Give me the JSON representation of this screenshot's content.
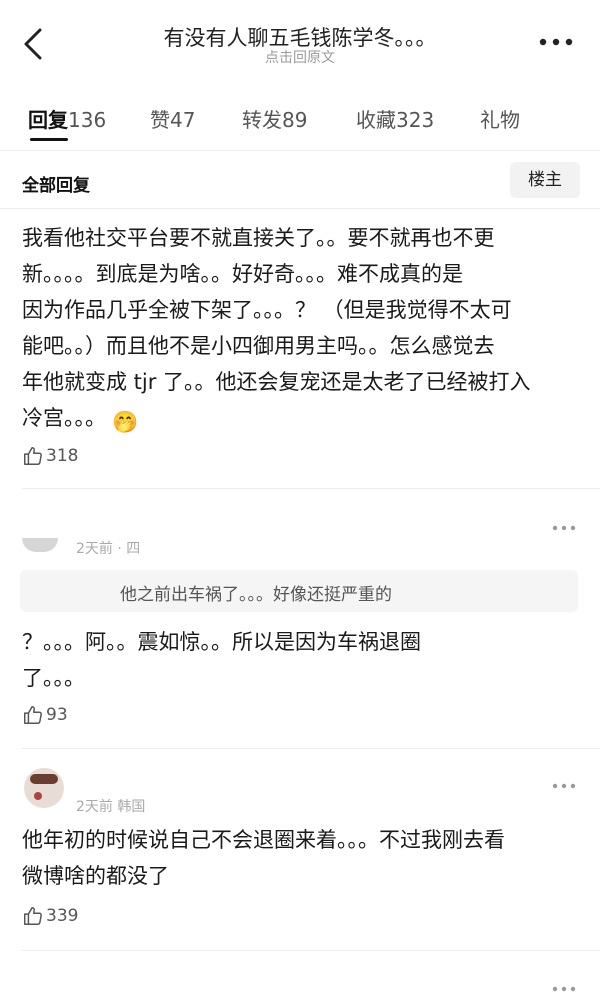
{
  "header": {
    "title": "有没有人聊五毛钱陈学冬。。。",
    "subtitle": "点击回原文"
  },
  "tabs": [
    {
      "label": "回复",
      "count": "136"
    },
    {
      "label": "赞",
      "count": "47"
    },
    {
      "label": "转发",
      "count": "89"
    },
    {
      "label": "收藏",
      "count": "323"
    },
    {
      "label": "礼物",
      "count": ""
    }
  ],
  "section": {
    "all_replies": "全部回复",
    "owner_button": "楼主"
  },
  "comments": [
    {
      "lines": [
        "我看他社交平台要不就直接关了。。要不就再也不更",
        "新。。。。到底是为啥。。好好奇。。。难不成真的是",
        "因为作品几乎全被下架了。。。？ （但是我觉得不太可",
        "能吧。。）而且他不是小四御用男主吗。。怎么感觉去",
        "年他就变成 tjr 了。。他还会复宠还是太老了已经被打入",
        "冷宫。。。"
      ],
      "emoji": "🤭",
      "likes": "318"
    },
    {
      "meta": "2天前 · 四",
      "quote": "他之前出车祸了。。。好像还挺严重的",
      "lines": [
        "？。。。阿。。震如惊。。所以是因为车祸退圈",
        "了。。。"
      ],
      "likes": "93"
    },
    {
      "meta": "2天前 韩国",
      "lines": [
        "他年初的时候说自己不会退圈来着。。。不过我刚去看",
        "微博啥的都没了"
      ],
      "likes": "339"
    }
  ],
  "icons": {
    "back": "chevron-left-icon",
    "more": "more-dots-icon",
    "like": "thumbs-up-icon",
    "comment_more": "more-dots-icon"
  },
  "colors": {
    "text": "#1a1a1a",
    "muted": "#9a9a9a",
    "divider": "#ededed"
  }
}
